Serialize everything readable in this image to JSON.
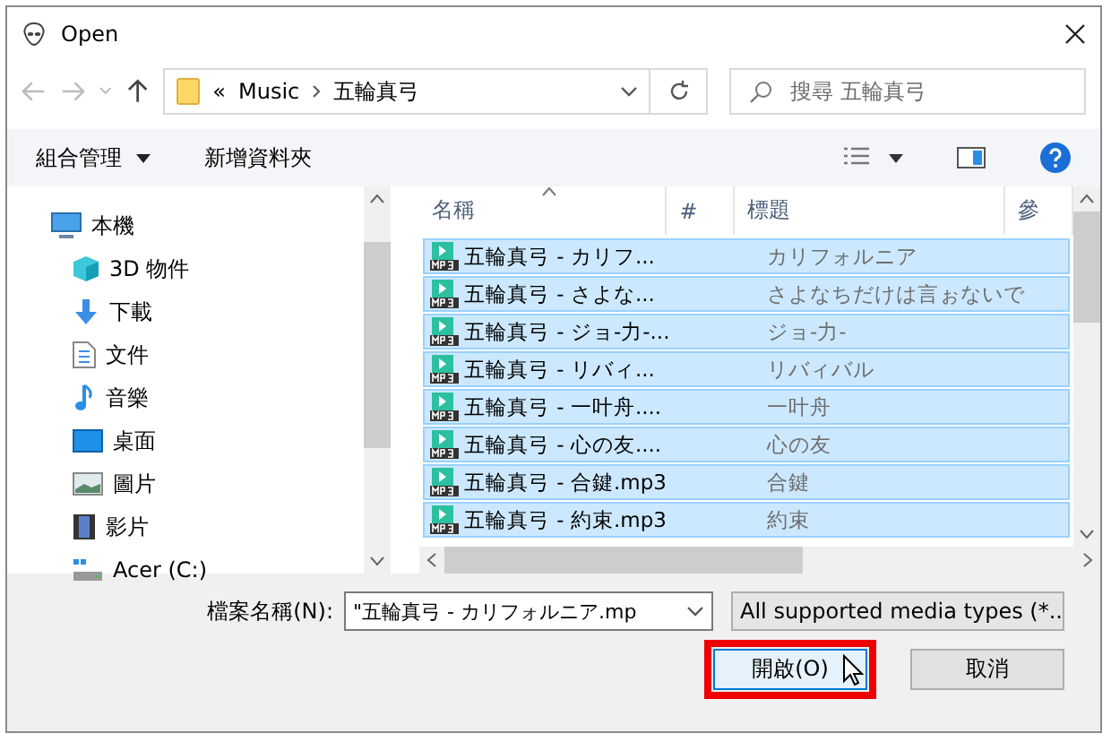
{
  "window": {
    "title": "Open"
  },
  "address": {
    "overflow": "«",
    "crumbs": [
      "Music",
      "五輪真弓"
    ]
  },
  "search": {
    "placeholder": "搜尋 五輪真弓"
  },
  "toolbar": {
    "organize": "組合管理",
    "new_folder": "新增資料夾"
  },
  "sidebar": {
    "items": [
      {
        "label": "本機",
        "kind": "pc",
        "children": [
          {
            "label": "3D 物件",
            "kind": "cube"
          },
          {
            "label": "下載",
            "kind": "download"
          },
          {
            "label": "文件",
            "kind": "document"
          },
          {
            "label": "音樂",
            "kind": "music"
          },
          {
            "label": "桌面",
            "kind": "desktop"
          },
          {
            "label": "圖片",
            "kind": "picture"
          },
          {
            "label": "影片",
            "kind": "video"
          },
          {
            "label": "Acer (C:)",
            "kind": "drive"
          }
        ]
      }
    ]
  },
  "table": {
    "columns": [
      {
        "label": "名稱",
        "sorted": true
      },
      {
        "label": "#",
        "sorted": false
      },
      {
        "label": "標題",
        "sorted": false
      },
      {
        "label": "參",
        "sorted": false
      }
    ],
    "rows": [
      {
        "name": "五輪真弓 - カリフ...",
        "title": "カリフォルニア",
        "selected": true
      },
      {
        "name": "五輪真弓 - さよな...",
        "title": "さよなちだけは言ぉないで",
        "selected": true
      },
      {
        "name": "五輪真弓 - ジョ-力-...",
        "title": "ジョ-力-",
        "selected": true
      },
      {
        "name": "五輪真弓 - リバィ...",
        "title": "リバィバル",
        "selected": true
      },
      {
        "name": "五輪真弓 - 一叶舟....",
        "title": "一叶舟",
        "selected": true
      },
      {
        "name": "五輪真弓 - 心の友....",
        "title": "心の友",
        "selected": true
      },
      {
        "name": "五輪真弓 - 合鍵.mp3",
        "title": "合鍵",
        "selected": true
      },
      {
        "name": "五輪真弓 - 約束.mp3",
        "title": "約束",
        "selected": true
      }
    ]
  },
  "filename": {
    "label": "檔案名稱(N):",
    "value": "\"五輪真弓 - カリフォルニア.mp"
  },
  "filter": {
    "value": "All supported media types (*.."
  },
  "buttons": [
    {
      "label": "開啟(O)",
      "kind": "primary",
      "highlighted": true
    },
    {
      "label": "取消",
      "kind": "normal",
      "highlighted": false
    }
  ]
}
